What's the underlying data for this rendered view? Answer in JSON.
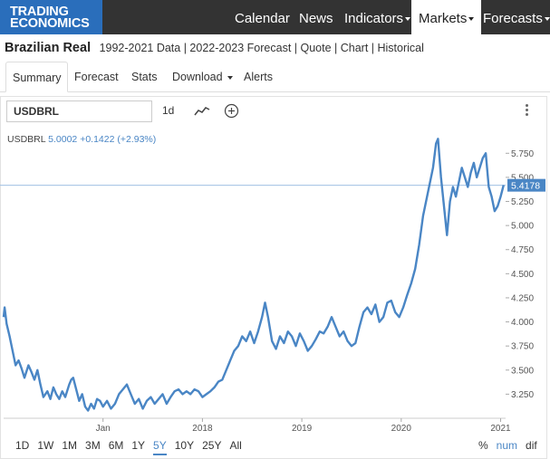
{
  "brand": {
    "line1": "TRADING",
    "line2": "ECONOMICS"
  },
  "nav": {
    "calendar": "Calendar",
    "news": "News",
    "indicators": "Indicators",
    "markets": "Markets",
    "forecasts": "Forecasts"
  },
  "title": {
    "name": "Brazilian Real",
    "links": "1992-2021 Data | 2022-2023 Forecast | Quote | Chart | Historical"
  },
  "tabs": {
    "summary": "Summary",
    "forecast": "Forecast",
    "stats": "Stats",
    "download": "Download",
    "alerts": "Alerts"
  },
  "toolbar": {
    "symbol": "USDBRL",
    "interval": "1d",
    "line_icon": "line-chart-icon",
    "add_icon": "plus-circle-icon",
    "menu_icon": "vertical-dots-icon"
  },
  "legend": {
    "symbol": "USDBRL",
    "value": "5.0002",
    "change": "+0.1422 (+2.93%)"
  },
  "ranges": [
    "1D",
    "1W",
    "1M",
    "3M",
    "6M",
    "1Y",
    "5Y",
    "10Y",
    "25Y",
    "All"
  ],
  "active_range": "5Y",
  "units": [
    "%",
    "num",
    "dif"
  ],
  "active_unit": "num",
  "colors": {
    "accent": "#4a86c5",
    "topbar": "#333333",
    "logo": "#2a6ebb"
  },
  "chart_data": {
    "type": "line",
    "series": [
      {
        "name": "USDBRL",
        "points": [
          [
            2016.0,
            4.05
          ],
          [
            2016.01,
            4.15
          ],
          [
            2016.03,
            3.98
          ],
          [
            2016.06,
            3.85
          ],
          [
            2016.09,
            3.7
          ],
          [
            2016.12,
            3.55
          ],
          [
            2016.15,
            3.6
          ],
          [
            2016.18,
            3.52
          ],
          [
            2016.21,
            3.42
          ],
          [
            2016.25,
            3.55
          ],
          [
            2016.28,
            3.48
          ],
          [
            2016.31,
            3.4
          ],
          [
            2016.34,
            3.5
          ],
          [
            2016.37,
            3.35
          ],
          [
            2016.4,
            3.22
          ],
          [
            2016.44,
            3.28
          ],
          [
            2016.47,
            3.2
          ],
          [
            2016.5,
            3.32
          ],
          [
            2016.53,
            3.25
          ],
          [
            2016.56,
            3.2
          ],
          [
            2016.59,
            3.28
          ],
          [
            2016.62,
            3.22
          ],
          [
            2016.66,
            3.35
          ],
          [
            2016.68,
            3.4
          ],
          [
            2016.7,
            3.42
          ],
          [
            2016.73,
            3.3
          ],
          [
            2016.76,
            3.18
          ],
          [
            2016.79,
            3.25
          ],
          [
            2016.82,
            3.12
          ],
          [
            2016.85,
            3.08
          ],
          [
            2016.88,
            3.15
          ],
          [
            2016.91,
            3.1
          ],
          [
            2016.94,
            3.2
          ],
          [
            2016.97,
            3.18
          ],
          [
            2017.0,
            3.12
          ],
          [
            2017.04,
            3.18
          ],
          [
            2017.08,
            3.1
          ],
          [
            2017.12,
            3.15
          ],
          [
            2017.16,
            3.25
          ],
          [
            2017.2,
            3.3
          ],
          [
            2017.24,
            3.35
          ],
          [
            2017.28,
            3.25
          ],
          [
            2017.32,
            3.15
          ],
          [
            2017.36,
            3.2
          ],
          [
            2017.4,
            3.1
          ],
          [
            2017.44,
            3.18
          ],
          [
            2017.48,
            3.22
          ],
          [
            2017.52,
            3.15
          ],
          [
            2017.56,
            3.2
          ],
          [
            2017.6,
            3.25
          ],
          [
            2017.64,
            3.15
          ],
          [
            2017.68,
            3.22
          ],
          [
            2017.72,
            3.28
          ],
          [
            2017.76,
            3.3
          ],
          [
            2017.8,
            3.25
          ],
          [
            2017.84,
            3.28
          ],
          [
            2017.88,
            3.25
          ],
          [
            2017.92,
            3.3
          ],
          [
            2017.96,
            3.28
          ],
          [
            2018.0,
            3.22
          ],
          [
            2018.04,
            3.25
          ],
          [
            2018.08,
            3.28
          ],
          [
            2018.12,
            3.32
          ],
          [
            2018.16,
            3.38
          ],
          [
            2018.2,
            3.4
          ],
          [
            2018.24,
            3.5
          ],
          [
            2018.28,
            3.6
          ],
          [
            2018.32,
            3.7
          ],
          [
            2018.36,
            3.75
          ],
          [
            2018.4,
            3.85
          ],
          [
            2018.44,
            3.8
          ],
          [
            2018.48,
            3.9
          ],
          [
            2018.52,
            3.78
          ],
          [
            2018.56,
            3.9
          ],
          [
            2018.6,
            4.05
          ],
          [
            2018.63,
            4.2
          ],
          [
            2018.66,
            4.05
          ],
          [
            2018.7,
            3.8
          ],
          [
            2018.74,
            3.72
          ],
          [
            2018.78,
            3.85
          ],
          [
            2018.82,
            3.78
          ],
          [
            2018.86,
            3.9
          ],
          [
            2018.9,
            3.85
          ],
          [
            2018.94,
            3.75
          ],
          [
            2018.98,
            3.88
          ],
          [
            2019.02,
            3.8
          ],
          [
            2019.06,
            3.7
          ],
          [
            2019.1,
            3.75
          ],
          [
            2019.14,
            3.82
          ],
          [
            2019.18,
            3.9
          ],
          [
            2019.22,
            3.88
          ],
          [
            2019.26,
            3.95
          ],
          [
            2019.3,
            4.05
          ],
          [
            2019.34,
            3.95
          ],
          [
            2019.38,
            3.85
          ],
          [
            2019.42,
            3.9
          ],
          [
            2019.46,
            3.8
          ],
          [
            2019.5,
            3.75
          ],
          [
            2019.54,
            3.78
          ],
          [
            2019.58,
            3.95
          ],
          [
            2019.62,
            4.1
          ],
          [
            2019.66,
            4.15
          ],
          [
            2019.7,
            4.08
          ],
          [
            2019.74,
            4.18
          ],
          [
            2019.78,
            4.0
          ],
          [
            2019.82,
            4.05
          ],
          [
            2019.86,
            4.2
          ],
          [
            2019.9,
            4.22
          ],
          [
            2019.94,
            4.1
          ],
          [
            2019.98,
            4.05
          ],
          [
            2020.02,
            4.15
          ],
          [
            2020.06,
            4.28
          ],
          [
            2020.1,
            4.4
          ],
          [
            2020.14,
            4.55
          ],
          [
            2020.18,
            4.8
          ],
          [
            2020.22,
            5.1
          ],
          [
            2020.26,
            5.3
          ],
          [
            2020.29,
            5.45
          ],
          [
            2020.32,
            5.6
          ],
          [
            2020.35,
            5.85
          ],
          [
            2020.37,
            5.9
          ],
          [
            2020.4,
            5.5
          ],
          [
            2020.43,
            5.2
          ],
          [
            2020.46,
            4.9
          ],
          [
            2020.49,
            5.25
          ],
          [
            2020.52,
            5.4
          ],
          [
            2020.55,
            5.3
          ],
          [
            2020.58,
            5.45
          ],
          [
            2020.61,
            5.6
          ],
          [
            2020.64,
            5.5
          ],
          [
            2020.67,
            5.4
          ],
          [
            2020.7,
            5.55
          ],
          [
            2020.73,
            5.65
          ],
          [
            2020.76,
            5.5
          ],
          [
            2020.79,
            5.6
          ],
          [
            2020.82,
            5.7
          ],
          [
            2020.85,
            5.75
          ],
          [
            2020.88,
            5.4
          ],
          [
            2020.91,
            5.3
          ],
          [
            2020.94,
            5.15
          ],
          [
            2020.97,
            5.2
          ],
          [
            2021.0,
            5.3
          ],
          [
            2021.03,
            5.42
          ]
        ]
      }
    ],
    "last_value": "5.4178",
    "last_value_num": 5.4178,
    "ylim": [
      3.0,
      5.95
    ],
    "xlim": [
      2016.0,
      2021.05
    ],
    "yticks": [
      3.25,
      3.5,
      3.75,
      4.0,
      4.25,
      4.5,
      4.75,
      5.0,
      5.25,
      5.5,
      5.75
    ],
    "ytick_labels": [
      "3.250",
      "3.500",
      "3.750",
      "4.000",
      "4.250",
      "4.500",
      "4.750",
      "5.000",
      "5.250",
      "5.500",
      "5.750"
    ],
    "xticks": [
      2017.0,
      2018.0,
      2019.0,
      2020.0,
      2021.0
    ],
    "xtick_labels": [
      "Jan",
      "2018",
      "2019",
      "2020",
      "2021"
    ],
    "grid": false
  }
}
